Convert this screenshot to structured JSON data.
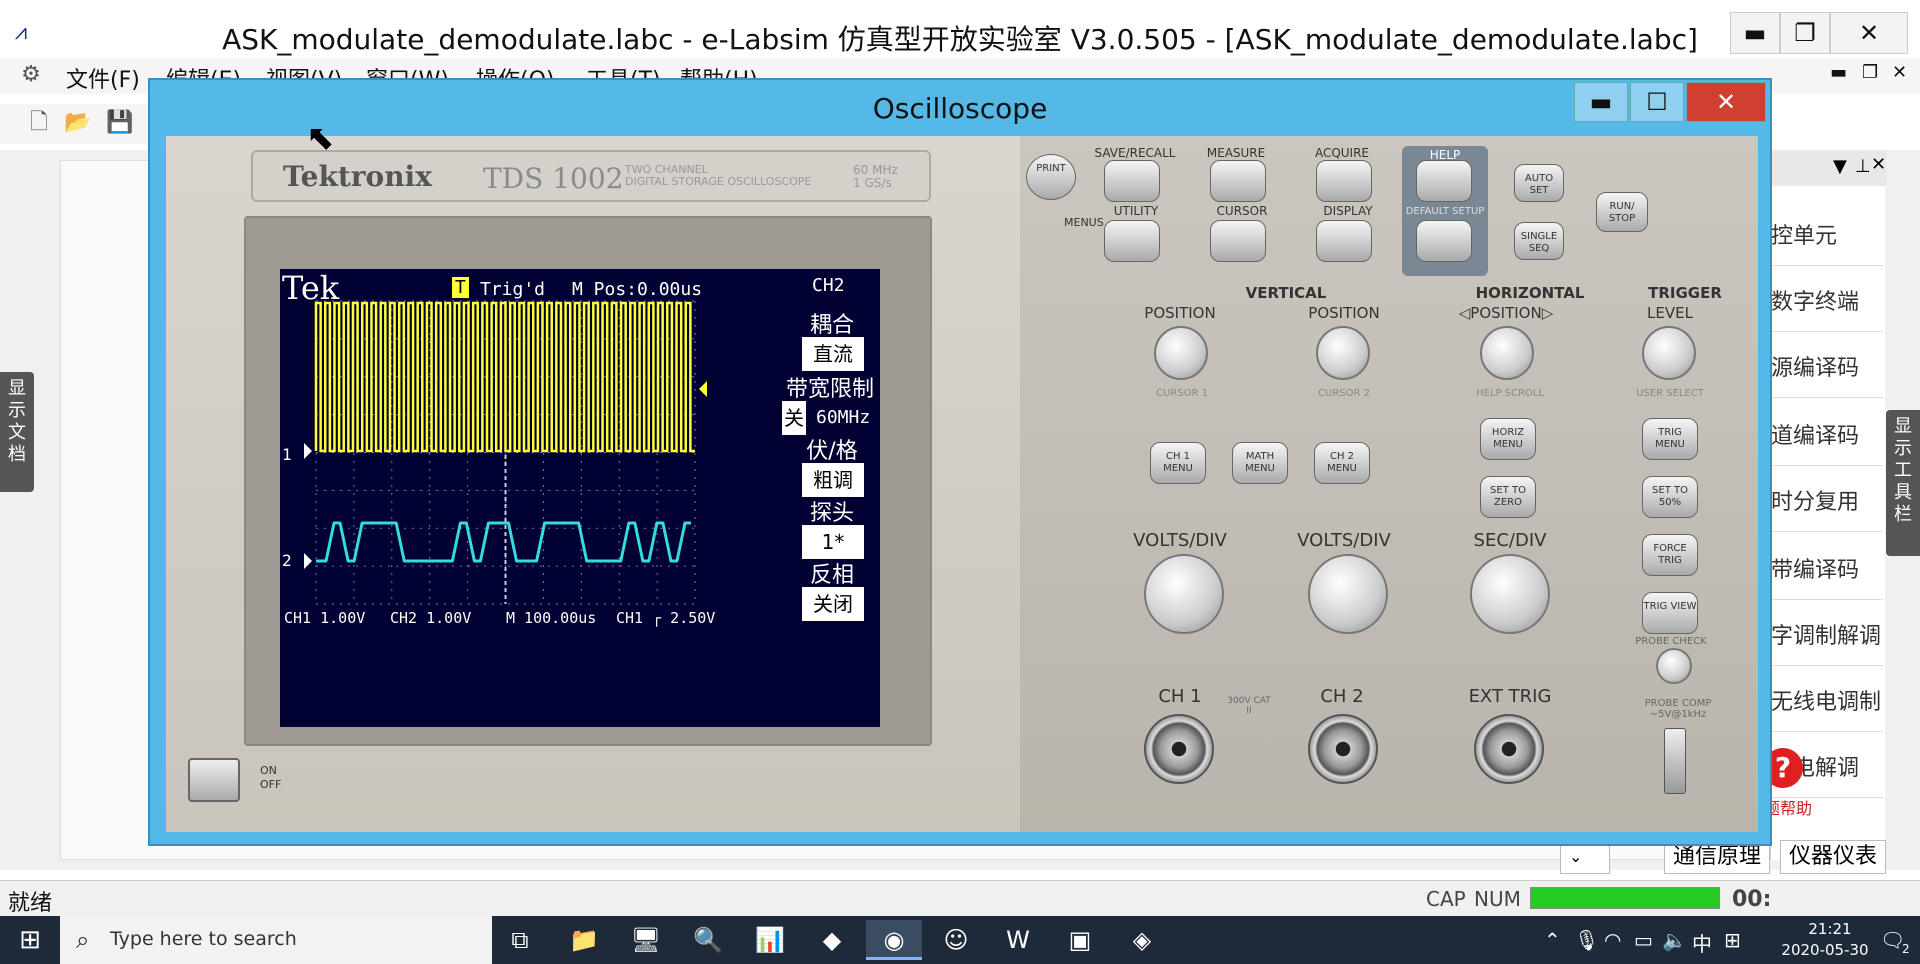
{
  "app": {
    "title": "ASK_modulate_demodulate.labc - e-Labsim 仿真型开放实验室 V3.0.505 - [ASK_modulate_demodulate.labc]",
    "minimize": "▬",
    "restore": "❐",
    "close": "✕"
  },
  "menu": [
    {
      "label": "文件(F)"
    },
    {
      "label": "编辑(E)"
    },
    {
      "label": "视图(V)"
    },
    {
      "label": "窗口(W)"
    },
    {
      "label": "操作(O)"
    },
    {
      "label": "工具(T)"
    },
    {
      "label": "帮助(H)"
    }
  ],
  "left_dock": {
    "label": "显示文档"
  },
  "right_dock": {
    "label": "显示工具栏"
  },
  "right_panel": {
    "items": [
      {
        "label": "控单元"
      },
      {
        "label": "数字终端"
      },
      {
        "label": "源编译码"
      },
      {
        "label": "道编译码"
      },
      {
        "label": "时分复用"
      },
      {
        "label": "带编译码"
      },
      {
        "label": "字调制解调"
      },
      {
        "label": "无线电调制"
      },
      {
        "label": "线电解调"
      }
    ]
  },
  "help": {
    "icon": "?",
    "label": "问题帮助"
  },
  "bottom_tabs": {
    "tab1": "通信原理",
    "tab2": "仪器仪表"
  },
  "status": {
    "text": "就绪",
    "cap": "CAP",
    "num": "NUM",
    "progress": 1.0,
    "time_prefix": "00:"
  },
  "oscilloscope": {
    "window_title": "Oscilloscope",
    "minimize": "▬",
    "restore": "☐",
    "close": "✕",
    "brand": "Tektronix",
    "model": "TDS 1002",
    "model_sub1": "TWO CHANNEL",
    "model_sub2": "DIGITAL STORAGE OSCILLOSCOPE",
    "spec1": "60 MHz",
    "spec2": "1 GS/s",
    "screen": {
      "logo": "Tek",
      "trig_marker": "T",
      "trig_status": "Trig'd",
      "mpos": "M Pos:0.00us",
      "channel_title": "CH2",
      "menu": [
        {
          "label": "耦合",
          "value": "直流"
        },
        {
          "label": "带宽限制",
          "value": "关",
          "extra": "60MHz"
        },
        {
          "label": "伏/格",
          "value": "粗调"
        },
        {
          "label": "探头",
          "value": "1*"
        },
        {
          "label": "反相",
          "value": "关闭"
        }
      ],
      "ch1_marker": "1",
      "ch2_marker": "2",
      "readout": {
        "ch1": "CH1 1.00V",
        "ch2": "CH2 1.00V",
        "time": "M 100.00us",
        "trig": "CH1 ┌ 2.50V"
      },
      "ch1_color": "#ffff33",
      "ch2_color": "#33dddd",
      "ch1_pulse_count": 41,
      "ch2_pattern": [
        0,
        1,
        0,
        1,
        1,
        1,
        0,
        0,
        0,
        0,
        1,
        0,
        1,
        1,
        0,
        0,
        1,
        1,
        1,
        0,
        0,
        0,
        1,
        0,
        1,
        0,
        1
      ]
    },
    "controls": {
      "print": "PRINT",
      "menus": "MENUS",
      "save_recall": "SAVE/RECALL",
      "measure": "MEASURE",
      "acquire": "ACQUIRE",
      "help": "HELP",
      "utility": "UTILITY",
      "cursor": "CURSOR",
      "display": "DISPLAY",
      "default_setup": "DEFAULT SETUP",
      "auto_set": "AUTO SET",
      "single_seq": "SINGLE SEQ",
      "run_stop": "RUN/ STOP",
      "vertical": "VERTICAL",
      "horizontal": "HORIZONTAL",
      "trigger": "TRIGGER",
      "position": "POSITION",
      "h_position": "◁POSITION▷",
      "level": "LEVEL",
      "cursor1": "CURSOR 1",
      "cursor2": "CURSOR 2",
      "help_scroll": "HELP SCROLL",
      "user_select": "USER SELECT",
      "ch1_menu": "CH 1 MENU",
      "math_menu": "MATH MENU",
      "ch2_menu": "CH 2 MENU",
      "horiz_menu": "HORIZ MENU",
      "set_to_zero": "SET TO ZERO",
      "trig_menu": "TRIG MENU",
      "set_to_50": "SET TO 50%",
      "force_trig": "FORCE TRIG",
      "trig_view": "TRIG VIEW",
      "probe_check": "PROBE CHECK",
      "volts_div": "VOLTS/DIV",
      "sec_div": "SEC/DIV",
      "ch1": "CH 1",
      "ch2": "CH 2",
      "ext_trig": "EXT TRIG",
      "cat": "300V CAT II",
      "probe_comp": "PROBE COMP ~5V@1kHz",
      "on": "ON",
      "off": "OFF"
    }
  },
  "taskbar": {
    "search_placeholder": "Type here to search",
    "time": "21:21",
    "date": "2020-05-30",
    "ime": "中",
    "notif_count": "2",
    "apps": [
      {
        "icon": "task-view-icon",
        "glyph": "⧉"
      },
      {
        "icon": "file-explorer-icon",
        "glyph": "📁"
      },
      {
        "icon": "network-drive-icon",
        "glyph": "🖥"
      },
      {
        "icon": "search-tool-icon",
        "glyph": "🔍"
      },
      {
        "icon": "spreadsheet-icon",
        "glyph": "📊"
      },
      {
        "icon": "visual-studio-icon",
        "glyph": "◆"
      },
      {
        "icon": "chrome-icon",
        "glyph": "◉"
      },
      {
        "icon": "elabsim-icon",
        "glyph": "☺"
      },
      {
        "icon": "word-icon",
        "glyph": "W"
      },
      {
        "icon": "photos-icon",
        "glyph": "▣"
      },
      {
        "icon": "app-icon",
        "glyph": "◈"
      }
    ]
  },
  "colors": {
    "osc_frame": "#55b9e8",
    "screen_bg": "#000033",
    "progress": "#22cc22",
    "help": "#e02020"
  }
}
